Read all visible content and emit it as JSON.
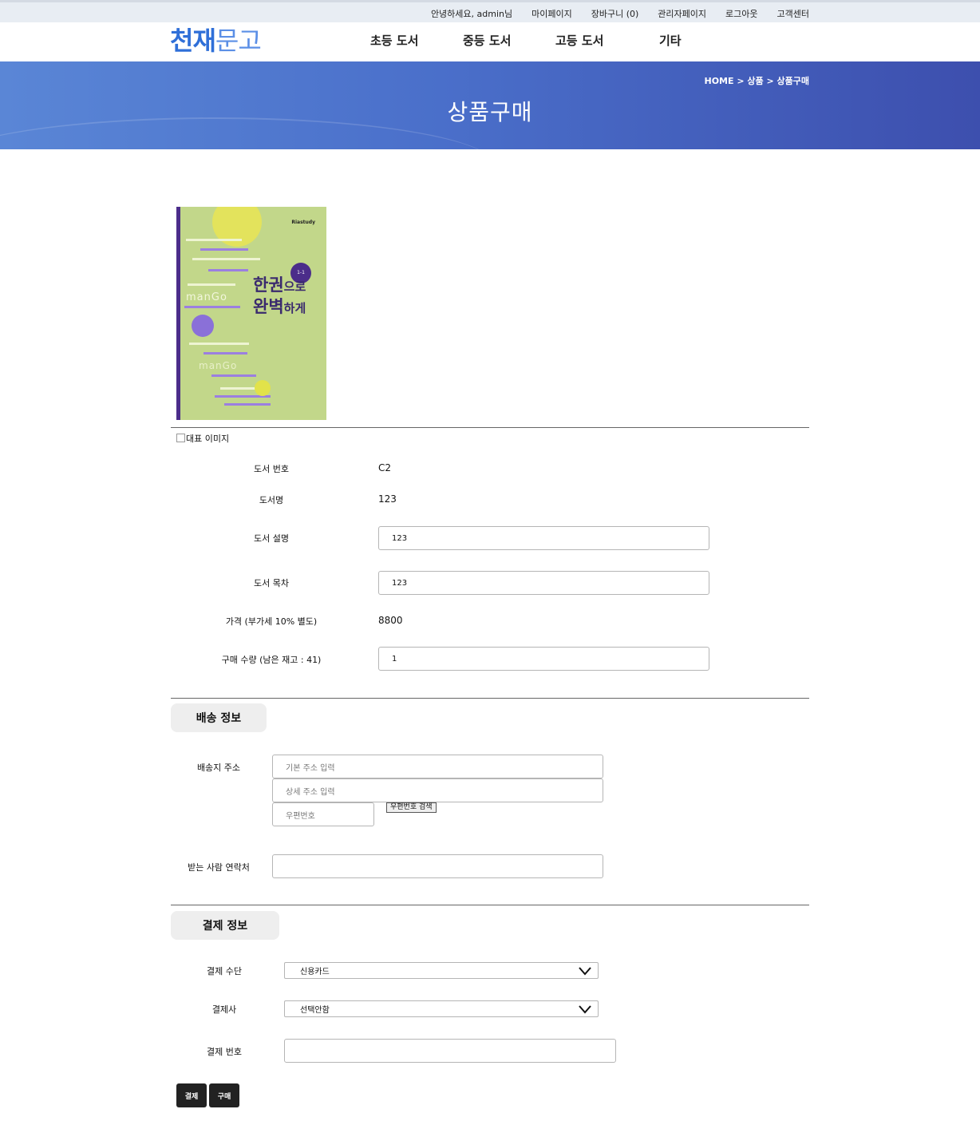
{
  "topbar": {
    "greeting": "안녕하세요, admin님",
    "mypage": "마이페이지",
    "cart": "장바구니 (0)",
    "admin": "관리자페이지",
    "logout": "로그아웃",
    "support": "고객센터"
  },
  "header": {
    "logo_part1": "천재",
    "logo_part2": "문고",
    "nav": [
      "초등 도서",
      "중등 도서",
      "고등 도서",
      "기타"
    ]
  },
  "banner": {
    "breadcrumb": "HOME > 상품 > 상품구매",
    "title": "상품구매"
  },
  "book_cover": {
    "publisher": "Riastudy",
    "badge": "1-1",
    "title_line1": "한권",
    "title_line1b": "으로",
    "title_line2": "완벽",
    "title_line2b": "하게",
    "watermark": "manGo"
  },
  "image_alt": "대표 이미지",
  "product": {
    "id_label": "도서 번호",
    "id_value": "C2",
    "name_label": "도서명",
    "name_value": "123",
    "desc_label": "도서 설명",
    "desc_value": "123",
    "toc_label": "도서 목차",
    "toc_value": "123",
    "price_label": "가격 (부가세 10% 별도)",
    "price_value": "8800",
    "qty_label": "구매 수량 (남은 재고 : 41)",
    "qty_value": "1"
  },
  "shipping": {
    "section_title": "배송 정보",
    "address_label": "배송지 주소",
    "address_placeholder": "기본 주소 입력",
    "detail_placeholder": "상세 주소 입력",
    "zip_placeholder": "우편번호",
    "zip_button": "우편번호 검색",
    "phone_label": "받는 사람 연락처",
    "phone_value": ""
  },
  "payment": {
    "section_title": "결제 정보",
    "method_label": "결제 수단",
    "method_value": "신용카드",
    "provider_label": "결제사",
    "provider_value": "선택안함",
    "number_label": "결제 번호",
    "number_value": ""
  },
  "actions": {
    "pay": "결제",
    "buy": "구매"
  },
  "colors": {
    "logo_primary": "#2f6fd8",
    "banner_start": "#5a86d6",
    "banner_end": "#3d4fae",
    "button_dark": "#222222"
  }
}
